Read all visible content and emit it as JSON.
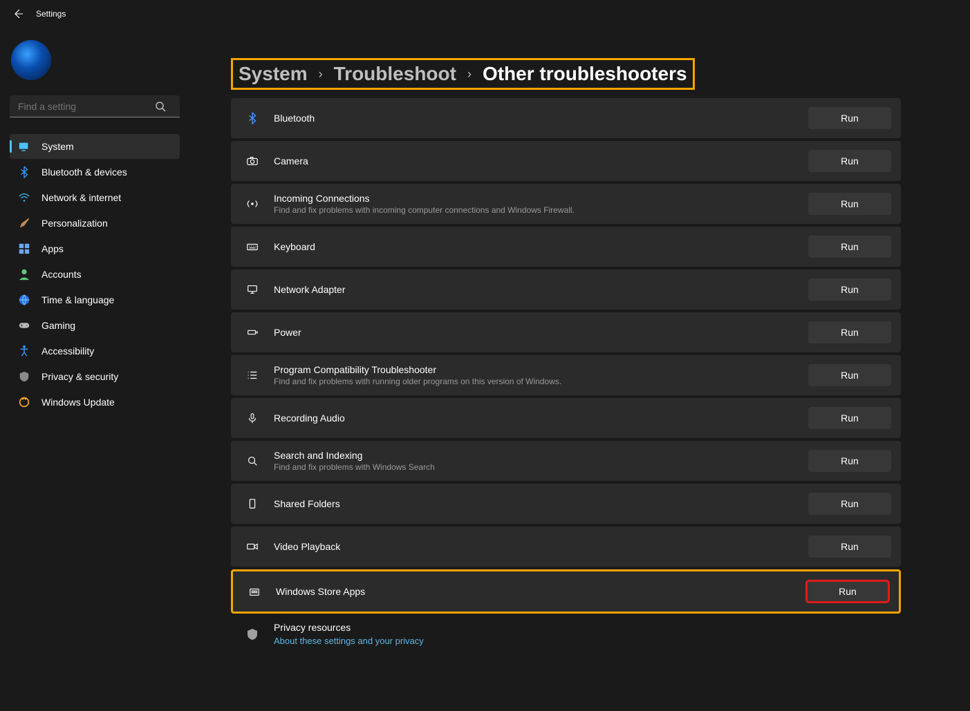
{
  "header": {
    "title": "Settings"
  },
  "search": {
    "placeholder": "Find a setting"
  },
  "nav": [
    {
      "key": "system",
      "label": "System",
      "active": true,
      "icon": "system"
    },
    {
      "key": "bluetooth",
      "label": "Bluetooth & devices",
      "active": false,
      "icon": "bluetooth"
    },
    {
      "key": "network",
      "label": "Network & internet",
      "active": false,
      "icon": "wifi"
    },
    {
      "key": "personalization",
      "label": "Personalization",
      "active": false,
      "icon": "brush"
    },
    {
      "key": "apps",
      "label": "Apps",
      "active": false,
      "icon": "apps"
    },
    {
      "key": "accounts",
      "label": "Accounts",
      "active": false,
      "icon": "person"
    },
    {
      "key": "time",
      "label": "Time & language",
      "active": false,
      "icon": "globe"
    },
    {
      "key": "gaming",
      "label": "Gaming",
      "active": false,
      "icon": "gaming"
    },
    {
      "key": "accessibility",
      "label": "Accessibility",
      "active": false,
      "icon": "accessibility"
    },
    {
      "key": "privacy",
      "label": "Privacy & security",
      "active": false,
      "icon": "shield"
    },
    {
      "key": "update",
      "label": "Windows Update",
      "active": false,
      "icon": "update"
    }
  ],
  "breadcrumb": [
    {
      "label": "System",
      "current": false
    },
    {
      "label": "Troubleshoot",
      "current": false
    },
    {
      "label": "Other troubleshooters",
      "current": true
    }
  ],
  "run_label": "Run",
  "troubleshooters": [
    {
      "key": "bluetooth-ts",
      "title": "Bluetooth",
      "desc": "",
      "icon": "bluetooth",
      "highlight": false
    },
    {
      "key": "camera-ts",
      "title": "Camera",
      "desc": "",
      "icon": "camera",
      "highlight": false
    },
    {
      "key": "incoming-ts",
      "title": "Incoming Connections",
      "desc": "Find and fix problems with incoming computer connections and Windows Firewall.",
      "icon": "incoming",
      "highlight": false
    },
    {
      "key": "keyboard-ts",
      "title": "Keyboard",
      "desc": "",
      "icon": "keyboard",
      "highlight": false
    },
    {
      "key": "netadapter-ts",
      "title": "Network Adapter",
      "desc": "",
      "icon": "monitor",
      "highlight": false
    },
    {
      "key": "power-ts",
      "title": "Power",
      "desc": "",
      "icon": "power",
      "highlight": false
    },
    {
      "key": "progcompat-ts",
      "title": "Program Compatibility Troubleshooter",
      "desc": "Find and fix problems with running older programs on this version of Windows.",
      "icon": "list",
      "highlight": false
    },
    {
      "key": "recaudio-ts",
      "title": "Recording Audio",
      "desc": "",
      "icon": "mic",
      "highlight": false
    },
    {
      "key": "search-ts",
      "title": "Search and Indexing",
      "desc": "Find and fix problems with Windows Search",
      "icon": "search",
      "highlight": false
    },
    {
      "key": "shared-ts",
      "title": "Shared Folders",
      "desc": "",
      "icon": "sharedfolder",
      "highlight": false
    },
    {
      "key": "video-ts",
      "title": "Video Playback",
      "desc": "",
      "icon": "video",
      "highlight": false
    },
    {
      "key": "store-ts",
      "title": "Windows Store Apps",
      "desc": "",
      "icon": "store",
      "highlight": true
    }
  ],
  "privacy": {
    "title": "Privacy resources",
    "link": "About these settings and your privacy"
  }
}
